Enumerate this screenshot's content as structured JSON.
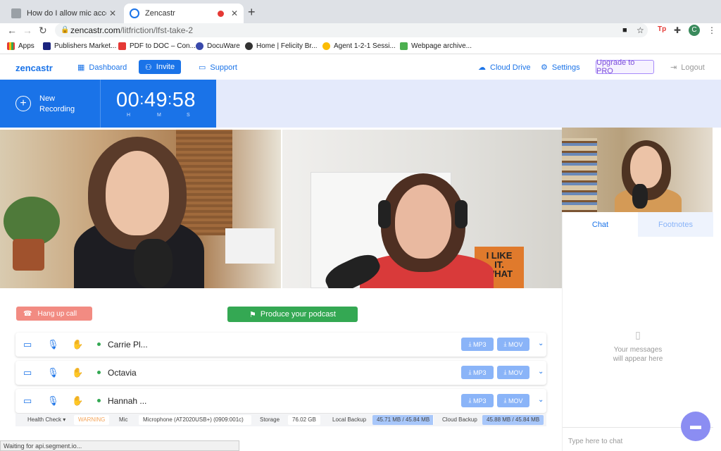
{
  "browser": {
    "tabs": [
      {
        "title": "How do I allow mic access? | Z"
      },
      {
        "title": "Zencastr"
      }
    ],
    "url_host": "zencastr.com",
    "url_path": "/litfriction/lfst-take-2",
    "profile_initial": "C",
    "bookmarks": [
      "Apps",
      "Publishers Market...",
      "PDF to DOC – Con...",
      "DocuWare",
      "Home | Felicity Br...",
      "Agent 1-2-1 Sessi...",
      "Webpage archive..."
    ]
  },
  "app": {
    "logo": "zencastr",
    "nav": {
      "dashboard": "Dashboard",
      "invite": "Invite",
      "support": "Support",
      "cloud_drive": "Cloud Drive",
      "settings": "Settings",
      "upgrade": "Upgrade to PRO",
      "logout": "Logout"
    }
  },
  "recording": {
    "label_line1": "New",
    "label_line2": "Recording",
    "hours": "00",
    "minutes": "49",
    "seconds": "58",
    "unit_h": "H",
    "unit_m": "M",
    "unit_s": "S"
  },
  "videos": {
    "poster_text_1": "I LIKE",
    "poster_text_2": "IT.",
    "poster_text_3": "WHAT"
  },
  "actions": {
    "hangup": "Hang up call",
    "produce": "Produce your podcast"
  },
  "participants": [
    {
      "name": "Carrie Pl...",
      "mp3": "MP3",
      "mov": "MOV"
    },
    {
      "name": "Octavia",
      "mp3": "MP3",
      "mov": "MOV"
    },
    {
      "name": "Hannah ...",
      "mp3": "MP3",
      "mov": "MOV"
    }
  ],
  "health": {
    "label": "Health Check",
    "status": "WARNING",
    "mic_label": "Mic",
    "mic_value": "Microphone (AT2020USB+) (0909:001c)",
    "storage_label": "Storage",
    "storage_value": "76.02 GB",
    "local_label": "Local Backup",
    "local_value": "45.71 MB / 45.84 MB",
    "cloud_label": "Cloud Backup",
    "cloud_value": "45.88 MB / 45.84 MB"
  },
  "chat": {
    "tab_chat": "Chat",
    "tab_footnotes": "Footnotes",
    "empty_line1": "Your messages",
    "empty_line2": "will appear here",
    "placeholder": "Type here to chat"
  },
  "status_bar": "Waiting for api.segment.io...",
  "colors": {
    "accent": "#1a73e8",
    "hangup": "#f28b82",
    "produce": "#34a853",
    "upgrade": "#7c4ddb"
  }
}
